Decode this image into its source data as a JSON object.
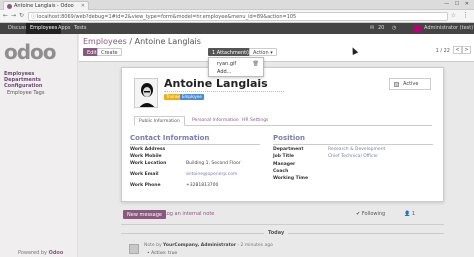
{
  "browser": {
    "tab_title": "Antoine Langlais - Odoo",
    "window_controls": "— ☐ ✕",
    "url": "localhost:8069/web?debug=1#id=2&view_type=form&model=hr.employee&menu_id=89&action=105"
  },
  "topnav": {
    "apps": [
      "Discuss",
      "Employees",
      "Apps",
      "Tests"
    ],
    "active_app": "Employees",
    "notif_count": "20",
    "user": "Administrator (test)"
  },
  "sidebar": {
    "logo": "odoo",
    "items": [
      "Employees",
      "Departments",
      "Configuration",
      "Employee Tags"
    ],
    "powered_by": "Powered by",
    "powered_brand": "Odoo"
  },
  "control_panel": {
    "breadcrumb_parent": "Employees",
    "breadcrumb_sep": "/",
    "breadcrumb_current": "Antoine Langlais",
    "edit_label": "Edit",
    "create_label": "Create",
    "attachment_label": "1 Attachment(s) ▾",
    "action_label": "Action ▾",
    "pager": "1 / 22",
    "prev": "<",
    "next": ">"
  },
  "attachment_dropdown": {
    "file": "ryan.gif",
    "add_label": "Add..."
  },
  "employee": {
    "name": "Antoine Langlais",
    "tags": [
      "Trainee",
      "Employee"
    ],
    "active_label": "Active",
    "tabs": [
      "Public Information",
      "Personal Information",
      "HR Settings"
    ],
    "contact_title": "Contact Information",
    "contact_labels": [
      "Work Address",
      "Work Mobile",
      "Work Location",
      "Work Email",
      "Work Phone"
    ],
    "work_location": "Building 1, Second Floor",
    "work_email": "antoine@openerp.com",
    "work_phone": "+3281813700",
    "position_title": "Position",
    "position_labels": [
      "Department",
      "Job Title",
      "Manager",
      "Coach",
      "Working Time"
    ],
    "department": "Research & Development",
    "job_title": "Chief Technical Officer"
  },
  "chatter": {
    "new_message": "New message",
    "log_note": "Log an internal note",
    "following": "Following",
    "followers": "1",
    "today": "Today",
    "note_prefix": "Note by",
    "note_author": "YourCompany, Administrator",
    "note_time": "- 2 minutes ago",
    "note_body": "• Active: true"
  }
}
